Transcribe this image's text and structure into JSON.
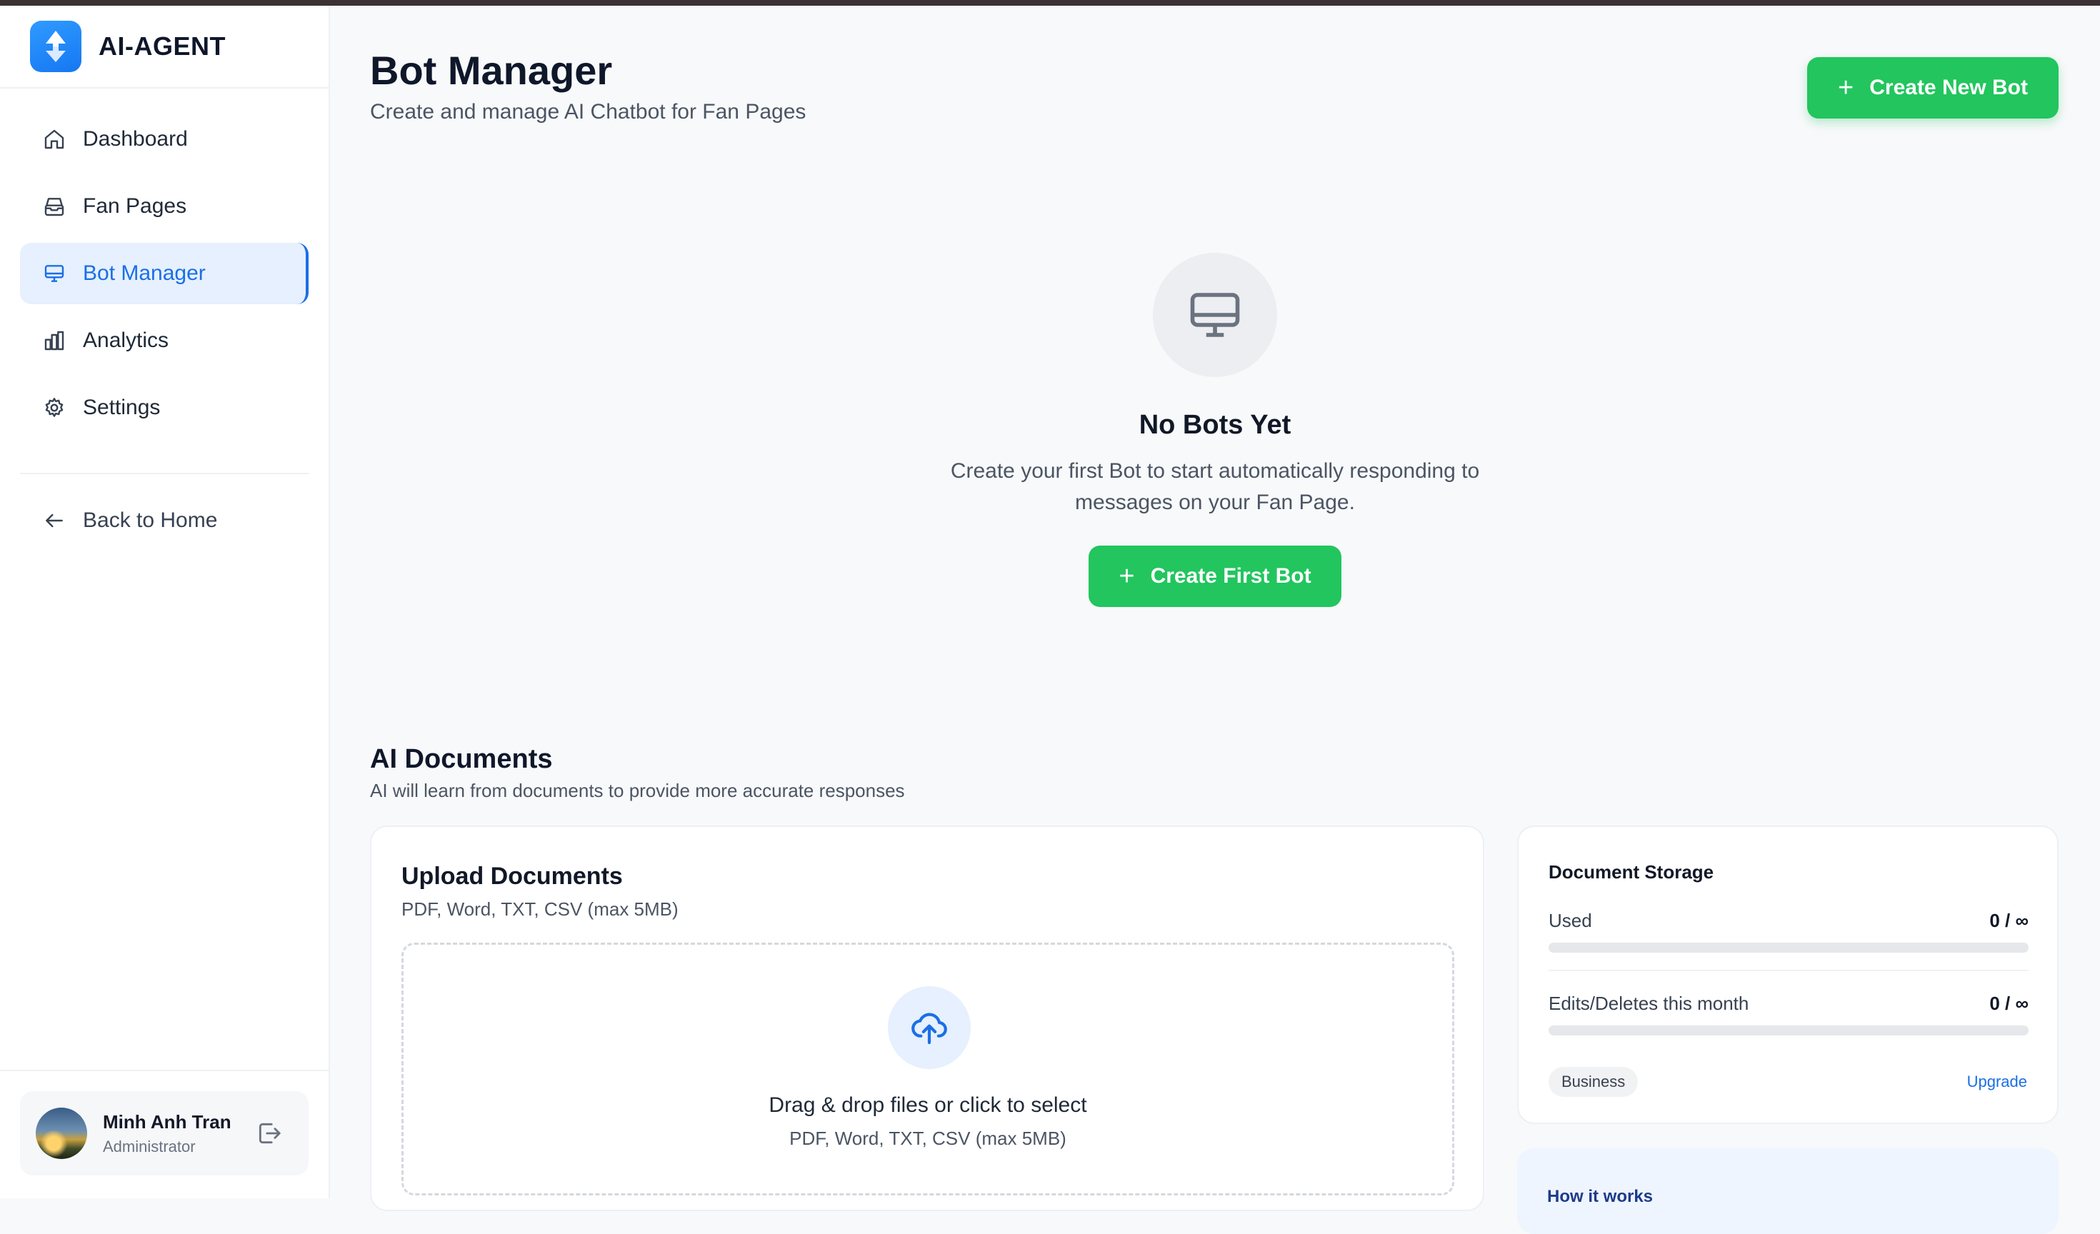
{
  "app": {
    "name": "AI-AGENT",
    "logo_icon": "bolt-arrows-icon",
    "accent_color": "#1a6fe6",
    "success_color": "#22c55e"
  },
  "sidebar": {
    "items": [
      {
        "label": "Dashboard",
        "icon": "home-icon",
        "active": false
      },
      {
        "label": "Fan Pages",
        "icon": "inbox-icon",
        "active": false
      },
      {
        "label": "Bot Manager",
        "icon": "monitor-icon",
        "active": true
      },
      {
        "label": "Analytics",
        "icon": "bar-chart-icon",
        "active": false
      },
      {
        "label": "Settings",
        "icon": "gear-icon",
        "active": false
      }
    ],
    "back_home": "Back to Home"
  },
  "user": {
    "name": "Minh Anh Tran",
    "role": "Administrator"
  },
  "header": {
    "title": "Bot Manager",
    "subtitle": "Create and manage AI Chatbot for Fan Pages",
    "create_button": "Create New Bot"
  },
  "empty_state": {
    "title": "No Bots Yet",
    "description": "Create your first Bot to start automatically responding to messages on your Fan Page.",
    "button": "Create First Bot"
  },
  "documents": {
    "title": "AI Documents",
    "subtitle": "AI will learn from documents to provide more accurate responses",
    "upload": {
      "title": "Upload Documents",
      "subtitle": "PDF, Word, TXT, CSV (max 5MB)",
      "drop_title": "Drag & drop files or click to select",
      "drop_sub": "PDF, Word, TXT, CSV (max 5MB)"
    },
    "storage": {
      "title": "Document Storage",
      "used_label": "Used",
      "used_value": "0 / ∞",
      "used_fraction": 0,
      "edits_label": "Edits/Deletes this month",
      "edits_value": "0 / ∞",
      "edits_fraction": 0,
      "plan": "Business",
      "upgrade": "Upgrade"
    },
    "how_it_works": "How it works"
  }
}
